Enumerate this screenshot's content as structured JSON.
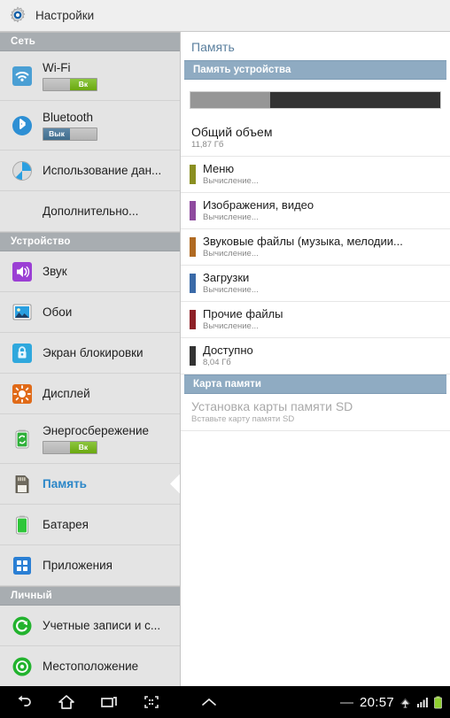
{
  "titlebar": {
    "icon": "settings-gear-icon",
    "title": "Настройки"
  },
  "sidebar": {
    "sections": [
      {
        "header": "Сеть",
        "items": [
          {
            "label": "Wi-Fi",
            "icon": "wifi-icon",
            "toggle": {
              "state": "on",
              "on_label": "Вк",
              "off_label": ""
            }
          },
          {
            "label": "Bluetooth",
            "icon": "bluetooth-icon",
            "toggle": {
              "state": "off",
              "on_label": "",
              "off_label": "Вык"
            }
          },
          {
            "label": "Использование дан...",
            "icon": "data-usage-icon"
          },
          {
            "label": "Дополнительно...",
            "icon": "none"
          }
        ]
      },
      {
        "header": "Устройство",
        "items": [
          {
            "label": "Звук",
            "icon": "sound-icon"
          },
          {
            "label": "Обои",
            "icon": "wallpaper-icon"
          },
          {
            "label": "Экран блокировки",
            "icon": "lock-screen-icon"
          },
          {
            "label": "Дисплей",
            "icon": "display-icon"
          },
          {
            "label": "Энергосбережение",
            "icon": "power-saving-icon",
            "toggle": {
              "state": "on",
              "on_label": "Вк",
              "off_label": ""
            }
          },
          {
            "label": "Память",
            "icon": "storage-icon",
            "selected": true
          },
          {
            "label": "Батарея",
            "icon": "battery-icon"
          },
          {
            "label": "Приложения",
            "icon": "apps-icon"
          }
        ]
      },
      {
        "header": "Личный",
        "items": [
          {
            "label": "Учетные записи и с...",
            "icon": "accounts-sync-icon"
          },
          {
            "label": "Местоположение",
            "icon": "location-icon"
          }
        ]
      }
    ]
  },
  "content": {
    "page_title": "Память",
    "device_storage_header": "Память устройства",
    "usage_bar": {
      "used_percent": 32,
      "used_color": "#969696",
      "free_color": "#333333"
    },
    "total": {
      "name": "Общий объем",
      "value": "11,87 Гб"
    },
    "categories": [
      {
        "name": "Меню",
        "value": "Вычисление...",
        "color": "#8a8f21"
      },
      {
        "name": "Изображения, видео",
        "value": "Вычисление...",
        "color": "#8e4a9e"
      },
      {
        "name": "Звуковые файлы (музыка, мелодии...",
        "value": "Вычисление...",
        "color": "#b06a22"
      },
      {
        "name": "Загрузки",
        "value": "Вычисление...",
        "color": "#3a6aa8"
      },
      {
        "name": "Прочие файлы",
        "value": "Вычисление...",
        "color": "#8d2026"
      },
      {
        "name": "Доступно",
        "value": "8,04 Гб",
        "color": "#333333"
      }
    ],
    "sd_header": "Карта памяти",
    "sd_item": {
      "name": "Установка карты памяти SD",
      "value": "Вставьте карту памяти SD"
    }
  },
  "navbar": {
    "back": "back-icon",
    "home": "home-icon",
    "recents": "recents-icon",
    "screenshot": "screenshot-icon",
    "expand": "chevron-up-icon",
    "dash": "—",
    "clock": "20:57",
    "wifi": "wifi-status-icon",
    "signal": "cellular-signal-icon",
    "battery": "battery-status-icon"
  },
  "colors": {
    "accent": "#2a86c8",
    "section_blue": "#8fabc2",
    "section_gray": "#a8adb1",
    "toggle_on": "#6aa80f"
  }
}
